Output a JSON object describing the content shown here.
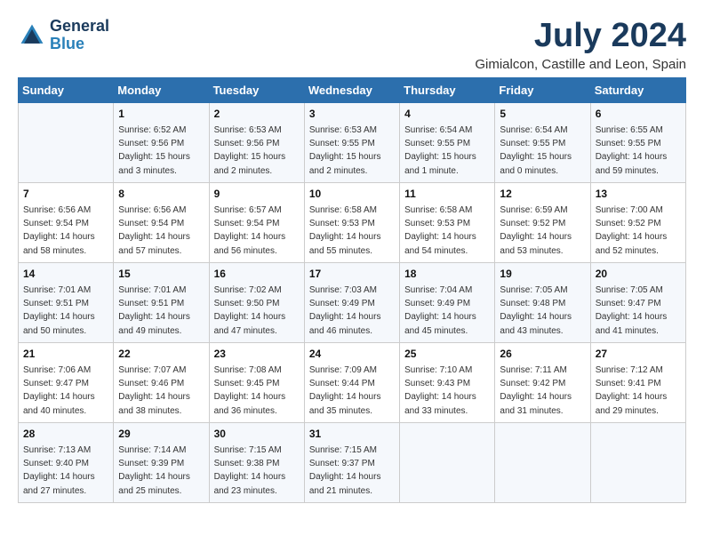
{
  "logo": {
    "line1": "General",
    "line2": "Blue"
  },
  "title": "July 2024",
  "location": "Gimialcon, Castille and Leon, Spain",
  "headers": [
    "Sunday",
    "Monday",
    "Tuesday",
    "Wednesday",
    "Thursday",
    "Friday",
    "Saturday"
  ],
  "weeks": [
    [
      {
        "day": "",
        "sunrise": "",
        "sunset": "",
        "daylight": ""
      },
      {
        "day": "1",
        "sunrise": "Sunrise: 6:52 AM",
        "sunset": "Sunset: 9:56 PM",
        "daylight": "Daylight: 15 hours and 3 minutes."
      },
      {
        "day": "2",
        "sunrise": "Sunrise: 6:53 AM",
        "sunset": "Sunset: 9:56 PM",
        "daylight": "Daylight: 15 hours and 2 minutes."
      },
      {
        "day": "3",
        "sunrise": "Sunrise: 6:53 AM",
        "sunset": "Sunset: 9:55 PM",
        "daylight": "Daylight: 15 hours and 2 minutes."
      },
      {
        "day": "4",
        "sunrise": "Sunrise: 6:54 AM",
        "sunset": "Sunset: 9:55 PM",
        "daylight": "Daylight: 15 hours and 1 minute."
      },
      {
        "day": "5",
        "sunrise": "Sunrise: 6:54 AM",
        "sunset": "Sunset: 9:55 PM",
        "daylight": "Daylight: 15 hours and 0 minutes."
      },
      {
        "day": "6",
        "sunrise": "Sunrise: 6:55 AM",
        "sunset": "Sunset: 9:55 PM",
        "daylight": "Daylight: 14 hours and 59 minutes."
      }
    ],
    [
      {
        "day": "7",
        "sunrise": "Sunrise: 6:56 AM",
        "sunset": "Sunset: 9:54 PM",
        "daylight": "Daylight: 14 hours and 58 minutes."
      },
      {
        "day": "8",
        "sunrise": "Sunrise: 6:56 AM",
        "sunset": "Sunset: 9:54 PM",
        "daylight": "Daylight: 14 hours and 57 minutes."
      },
      {
        "day": "9",
        "sunrise": "Sunrise: 6:57 AM",
        "sunset": "Sunset: 9:54 PM",
        "daylight": "Daylight: 14 hours and 56 minutes."
      },
      {
        "day": "10",
        "sunrise": "Sunrise: 6:58 AM",
        "sunset": "Sunset: 9:53 PM",
        "daylight": "Daylight: 14 hours and 55 minutes."
      },
      {
        "day": "11",
        "sunrise": "Sunrise: 6:58 AM",
        "sunset": "Sunset: 9:53 PM",
        "daylight": "Daylight: 14 hours and 54 minutes."
      },
      {
        "day": "12",
        "sunrise": "Sunrise: 6:59 AM",
        "sunset": "Sunset: 9:52 PM",
        "daylight": "Daylight: 14 hours and 53 minutes."
      },
      {
        "day": "13",
        "sunrise": "Sunrise: 7:00 AM",
        "sunset": "Sunset: 9:52 PM",
        "daylight": "Daylight: 14 hours and 52 minutes."
      }
    ],
    [
      {
        "day": "14",
        "sunrise": "Sunrise: 7:01 AM",
        "sunset": "Sunset: 9:51 PM",
        "daylight": "Daylight: 14 hours and 50 minutes."
      },
      {
        "day": "15",
        "sunrise": "Sunrise: 7:01 AM",
        "sunset": "Sunset: 9:51 PM",
        "daylight": "Daylight: 14 hours and 49 minutes."
      },
      {
        "day": "16",
        "sunrise": "Sunrise: 7:02 AM",
        "sunset": "Sunset: 9:50 PM",
        "daylight": "Daylight: 14 hours and 47 minutes."
      },
      {
        "day": "17",
        "sunrise": "Sunrise: 7:03 AM",
        "sunset": "Sunset: 9:49 PM",
        "daylight": "Daylight: 14 hours and 46 minutes."
      },
      {
        "day": "18",
        "sunrise": "Sunrise: 7:04 AM",
        "sunset": "Sunset: 9:49 PM",
        "daylight": "Daylight: 14 hours and 45 minutes."
      },
      {
        "day": "19",
        "sunrise": "Sunrise: 7:05 AM",
        "sunset": "Sunset: 9:48 PM",
        "daylight": "Daylight: 14 hours and 43 minutes."
      },
      {
        "day": "20",
        "sunrise": "Sunrise: 7:05 AM",
        "sunset": "Sunset: 9:47 PM",
        "daylight": "Daylight: 14 hours and 41 minutes."
      }
    ],
    [
      {
        "day": "21",
        "sunrise": "Sunrise: 7:06 AM",
        "sunset": "Sunset: 9:47 PM",
        "daylight": "Daylight: 14 hours and 40 minutes."
      },
      {
        "day": "22",
        "sunrise": "Sunrise: 7:07 AM",
        "sunset": "Sunset: 9:46 PM",
        "daylight": "Daylight: 14 hours and 38 minutes."
      },
      {
        "day": "23",
        "sunrise": "Sunrise: 7:08 AM",
        "sunset": "Sunset: 9:45 PM",
        "daylight": "Daylight: 14 hours and 36 minutes."
      },
      {
        "day": "24",
        "sunrise": "Sunrise: 7:09 AM",
        "sunset": "Sunset: 9:44 PM",
        "daylight": "Daylight: 14 hours and 35 minutes."
      },
      {
        "day": "25",
        "sunrise": "Sunrise: 7:10 AM",
        "sunset": "Sunset: 9:43 PM",
        "daylight": "Daylight: 14 hours and 33 minutes."
      },
      {
        "day": "26",
        "sunrise": "Sunrise: 7:11 AM",
        "sunset": "Sunset: 9:42 PM",
        "daylight": "Daylight: 14 hours and 31 minutes."
      },
      {
        "day": "27",
        "sunrise": "Sunrise: 7:12 AM",
        "sunset": "Sunset: 9:41 PM",
        "daylight": "Daylight: 14 hours and 29 minutes."
      }
    ],
    [
      {
        "day": "28",
        "sunrise": "Sunrise: 7:13 AM",
        "sunset": "Sunset: 9:40 PM",
        "daylight": "Daylight: 14 hours and 27 minutes."
      },
      {
        "day": "29",
        "sunrise": "Sunrise: 7:14 AM",
        "sunset": "Sunset: 9:39 PM",
        "daylight": "Daylight: 14 hours and 25 minutes."
      },
      {
        "day": "30",
        "sunrise": "Sunrise: 7:15 AM",
        "sunset": "Sunset: 9:38 PM",
        "daylight": "Daylight: 14 hours and 23 minutes."
      },
      {
        "day": "31",
        "sunrise": "Sunrise: 7:15 AM",
        "sunset": "Sunset: 9:37 PM",
        "daylight": "Daylight: 14 hours and 21 minutes."
      },
      {
        "day": "",
        "sunrise": "",
        "sunset": "",
        "daylight": ""
      },
      {
        "day": "",
        "sunrise": "",
        "sunset": "",
        "daylight": ""
      },
      {
        "day": "",
        "sunrise": "",
        "sunset": "",
        "daylight": ""
      }
    ]
  ]
}
